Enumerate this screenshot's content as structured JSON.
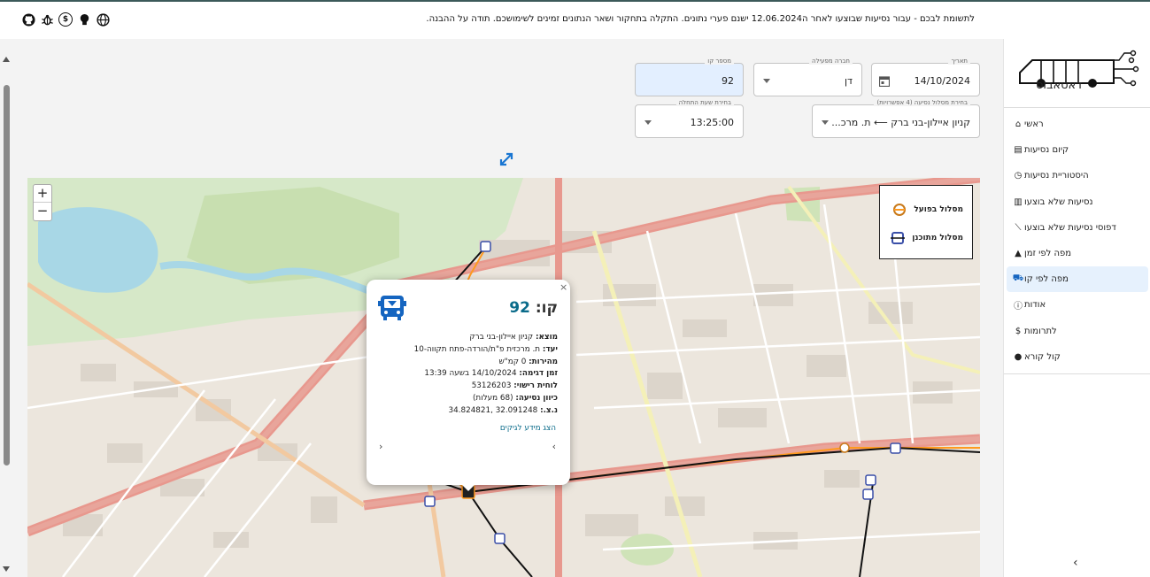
{
  "topbar": {
    "notice": "לתשומת לבכם - עבור נסיעות שבוצעו לאחר ה12.06.2024 ישנם פערי נתונים. התקלה בתחקור ושאר הנתונים זמינים לשימושכם. תודה על ההבנה."
  },
  "top_icons": [
    "github-icon",
    "bug-icon",
    "dollar-circle-icon",
    "lightbulb-icon",
    "globe-icon"
  ],
  "sidebar": {
    "logo_text": "דאטאבוס",
    "items": [
      {
        "label": "ראשי",
        "icon": "home-icon",
        "glyph": "⌂"
      },
      {
        "label": "קיום נסיעות",
        "icon": "table-icon",
        "glyph": "▤"
      },
      {
        "label": "היסטוריית נסיעות",
        "icon": "history-icon",
        "glyph": "◷"
      },
      {
        "label": "נסיעות שלא בוצעו",
        "icon": "bar-chart-icon",
        "glyph": "▥"
      },
      {
        "label": "דפוסי נסיעות שלא בוצעו",
        "icon": "line-chart-icon",
        "glyph": "⟋"
      },
      {
        "label": "מפה לפי זמן",
        "icon": "radar-icon",
        "glyph": "▲"
      },
      {
        "label": "מפה לפי קו",
        "icon": "bus-map-icon",
        "glyph": "⛟",
        "active": true
      },
      {
        "label": "אודות",
        "icon": "info-icon",
        "glyph": "ⓘ"
      },
      {
        "label": "לתרומות",
        "icon": "donate-icon",
        "glyph": "$"
      },
      {
        "label": "קול קורא",
        "icon": "pin-icon",
        "glyph": "●"
      }
    ]
  },
  "form": {
    "date": {
      "label": "תאריך",
      "value": "14/10/2024"
    },
    "operator": {
      "label": "חברה מפעילה",
      "value": "דן"
    },
    "line": {
      "label": "מספר קו",
      "value": "92"
    },
    "route": {
      "label": "בחירת מסלול נסיעה (4 אפשרויות)",
      "value": "קניון איילון-בני ברק ⟵ ת. מרכ..."
    },
    "start_time": {
      "label": "בחירת שעת התחלה",
      "value": "13:25:00"
    }
  },
  "map": {
    "zoom_in": "+",
    "zoom_out": "−",
    "legend": {
      "actual": "מסלול בפועל",
      "planned": "מסלול מתוכנן"
    },
    "popup": {
      "title_prefix": "קו:",
      "line_number": "92",
      "origin_label": "מוצא:",
      "origin": "קניון איילון-בני ברק",
      "destination_label": "יעד:",
      "destination": "ת. מרכזית פ\"ת/הורדה-פתח תקווה-10",
      "speed_label": "מהירות:",
      "speed": "0 קמ\"ש",
      "sample_time_label": "זמן דגימה:",
      "sample_time": "14/10/2024 בשעה 13:39",
      "plate_label": "לוחית רישוי:",
      "plate": "53126203",
      "direction_label": "כיוון נסיעה:",
      "direction": "(68 מעלות)",
      "coords_label": "נ.צ.:",
      "coords": "32.091248 ,34.824821",
      "dev_link": "הצג מידע לגיקים",
      "close": "×",
      "prev": "‹",
      "next": "›"
    }
  },
  "collapse": "‹"
}
